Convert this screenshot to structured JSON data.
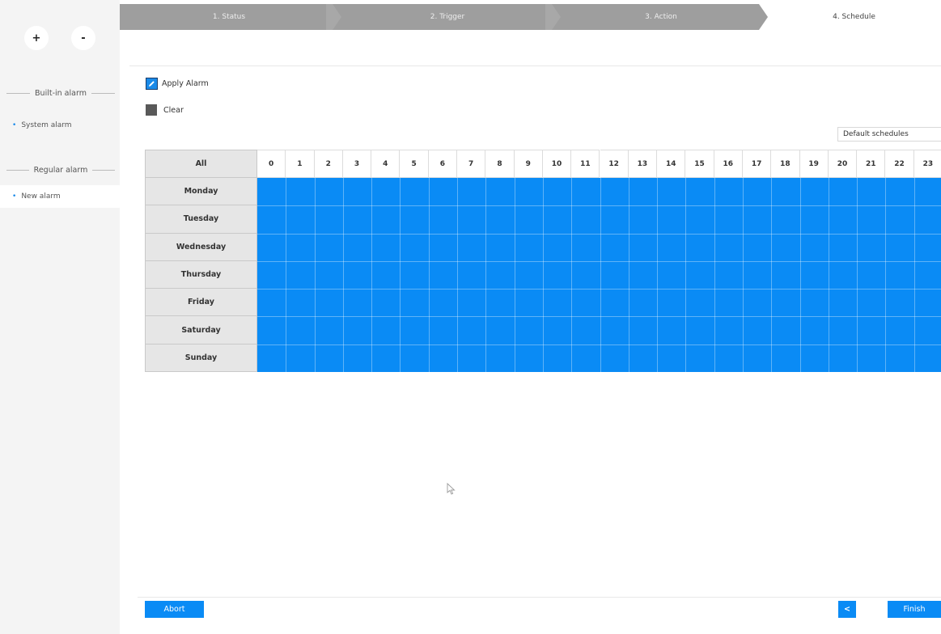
{
  "sidebar": {
    "add_label": "+",
    "remove_label": "-",
    "builtin_header": "Built-in alarm",
    "builtin_items": [
      "System alarm"
    ],
    "regular_header": "Regular alarm",
    "regular_items": [
      "New alarm"
    ]
  },
  "steps": [
    "1. Status",
    "2. Trigger",
    "3. Action",
    "4. Schedule"
  ],
  "active_step": "4. Schedule",
  "tools": {
    "apply_label": "Apply Alarm",
    "clear_label": "Clear"
  },
  "schedule_select": "Default schedules",
  "grid": {
    "all_label": "All",
    "hours": [
      "0",
      "1",
      "2",
      "3",
      "4",
      "5",
      "6",
      "7",
      "8",
      "9",
      "10",
      "11",
      "12",
      "13",
      "14",
      "15",
      "16",
      "17",
      "18",
      "19",
      "20",
      "21",
      "22",
      "23"
    ],
    "days": [
      "Monday",
      "Tuesday",
      "Wednesday",
      "Thursday",
      "Friday",
      "Saturday",
      "Sunday"
    ],
    "fill_color": "#0a8bf5"
  },
  "footer": {
    "abort_label": "Abort",
    "back_label": "<",
    "finish_label": "Finish"
  },
  "colors": {
    "accent": "#0a8bf5",
    "step_inactive": "#9e9e9e"
  }
}
